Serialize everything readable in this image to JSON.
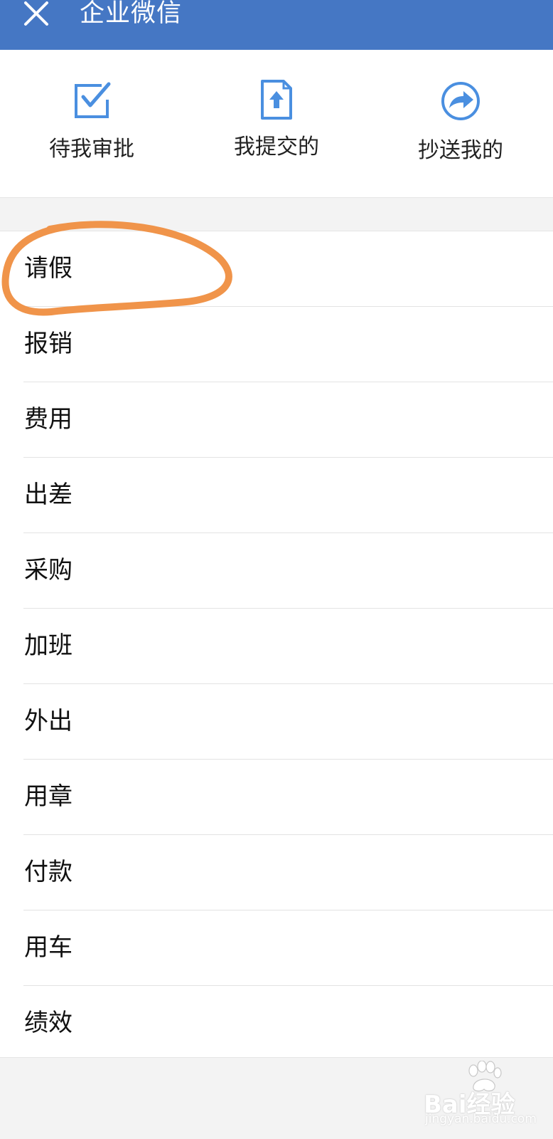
{
  "header": {
    "title": "企业微信",
    "close_icon": "close-icon",
    "bg_color": "#4577c4"
  },
  "quick_actions": [
    {
      "label": "待我审批",
      "icon": "checkbox-approve-icon"
    },
    {
      "label": "我提交的",
      "icon": "document-upload-icon"
    },
    {
      "label": "抄送我的",
      "icon": "forward-circle-icon"
    }
  ],
  "approval_types": [
    {
      "label": "请假"
    },
    {
      "label": "报销"
    },
    {
      "label": "费用"
    },
    {
      "label": "出差"
    },
    {
      "label": "采购"
    },
    {
      "label": "加班"
    },
    {
      "label": "外出"
    },
    {
      "label": "用章"
    },
    {
      "label": "付款"
    },
    {
      "label": "用车"
    },
    {
      "label": "绩效"
    }
  ],
  "annotation": {
    "type": "hand-drawn-ellipse",
    "color": "#f0944a",
    "target": "请假"
  },
  "watermark": {
    "brand": "Bai经验",
    "url": "jingyan.baidu.com"
  },
  "colors": {
    "accent": "#4a8fe0",
    "header": "#4577c4",
    "highlight": "#f0944a"
  }
}
